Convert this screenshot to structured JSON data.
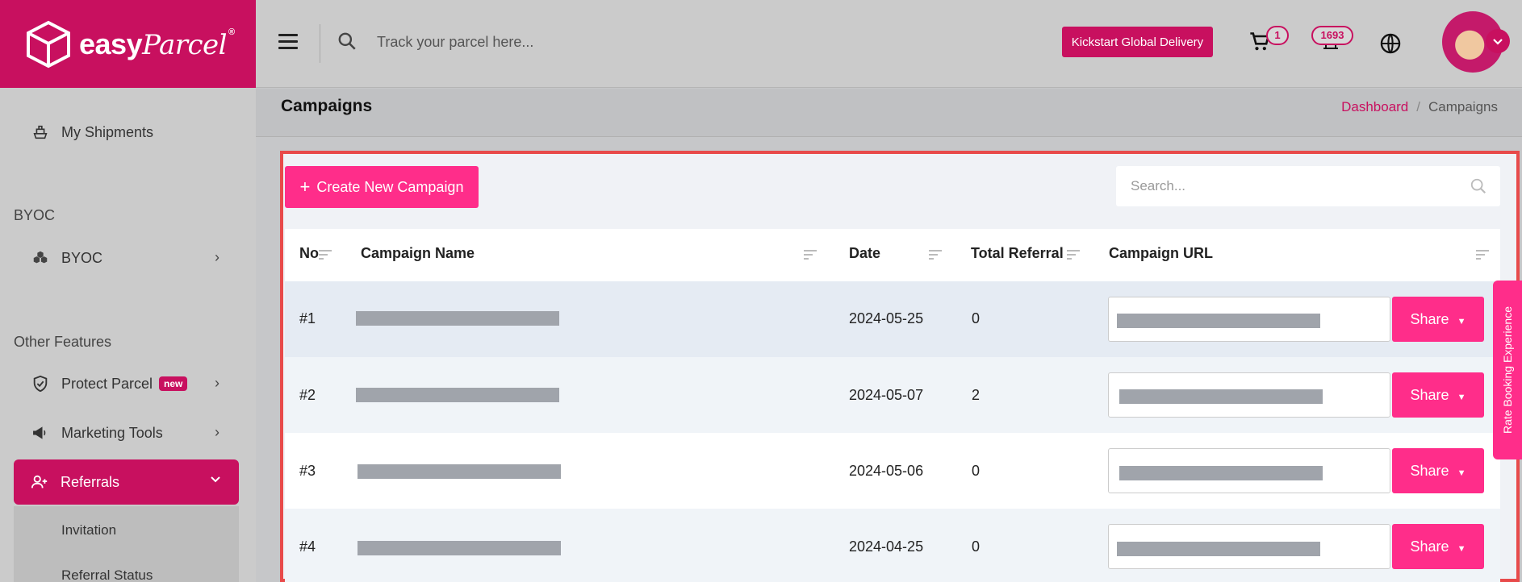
{
  "brand": {
    "name_1": "easy",
    "name_2": "Parcel",
    "reg": "®"
  },
  "sidebar": {
    "my_shipments": "My Shipments",
    "section_byoc": "BYOC",
    "byoc_item": "BYOC",
    "section_other": "Other Features",
    "protect_parcel": "Protect Parcel",
    "new_badge": "new",
    "marketing_tools": "Marketing Tools",
    "referrals": "Referrals",
    "sub_items": [
      "Invitation",
      "Referral Status"
    ]
  },
  "header": {
    "track_placeholder": "Track your parcel here...",
    "kickstart_label": "Kickstart Global Delivery",
    "cart_count": "1",
    "notification_count": "1693"
  },
  "page": {
    "title": "Campaigns",
    "breadcrumb": [
      "Dashboard",
      "Campaigns"
    ]
  },
  "toolbar": {
    "create_label": "Create New Campaign",
    "search_placeholder": "Search..."
  },
  "table": {
    "headers": {
      "no": "No",
      "name": "Campaign Name",
      "date": "Date",
      "referral": "Total Referral",
      "url": "Campaign URL"
    },
    "share_label": "Share",
    "rows": [
      {
        "no": "#1",
        "date": "2024-05-25",
        "referral": "0"
      },
      {
        "no": "#2",
        "date": "2024-05-07",
        "referral": "2"
      },
      {
        "no": "#3",
        "date": "2024-05-06",
        "referral": "0"
      },
      {
        "no": "#4",
        "date": "2024-04-25",
        "referral": "0"
      }
    ]
  },
  "side_tab": {
    "label": "Rate Booking Experience"
  },
  "colors": {
    "brand": "#c8105f",
    "button_pink": "#ff2d8a",
    "highlight_border": "#e84a4a"
  }
}
